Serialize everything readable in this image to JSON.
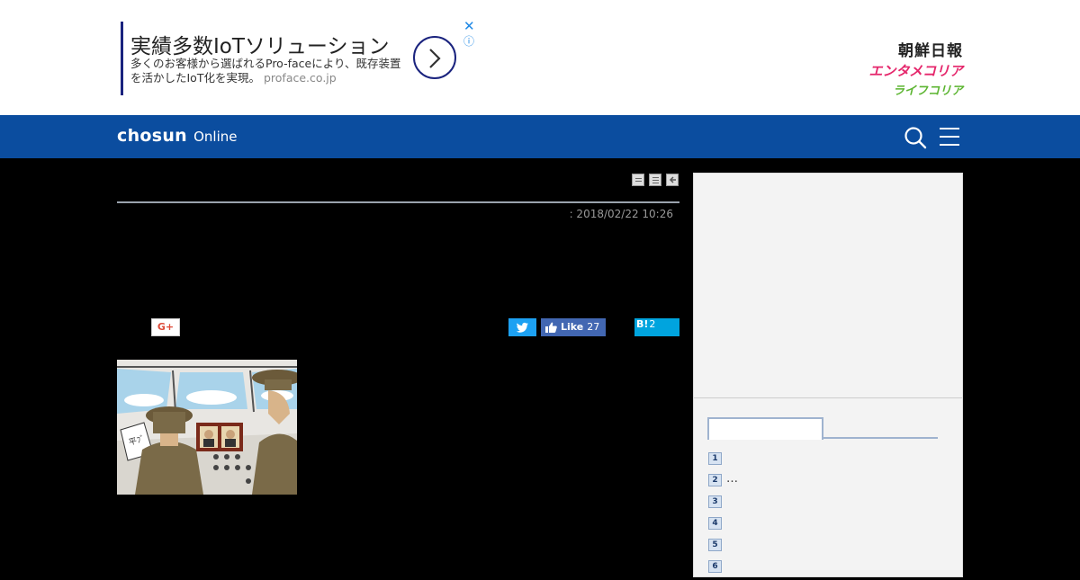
{
  "ad": {
    "title": "実績多数IoTソリューション",
    "description": "多くのお客様から選ばれるPro-faceにより、既存装置を活かしたIoT化を実現。",
    "domain": "proface.co.jp",
    "close_icon": "close-icon",
    "info_icon": "info-icon",
    "cta_icon": "chevron-right-icon"
  },
  "brands": {
    "chosun": "朝鮮日報",
    "entame": "エンタメコリア",
    "life": "ライフコリア",
    "entame_color": "#e5266b",
    "life_color": "#5cb531"
  },
  "nav": {
    "logo_main": "chosun",
    "logo_sub": "Online",
    "background": "#0b4d9f",
    "search_icon": "search-icon",
    "menu_icon": "hamburger-menu-icon"
  },
  "article": {
    "tool_icons": [
      "print-icon",
      "enlarge-text-icon",
      "back-icon"
    ],
    "date": ": 2018/02/22 10:26",
    "share": {
      "gplus_label": "G+",
      "facebook_label": "Like",
      "facebook_count": "27",
      "hatena_label": "B!",
      "hatena_count": "2"
    },
    "photo_icon": "cartoon-illustration"
  },
  "sidebar": {
    "ranking": [
      {
        "rank": "1",
        "text": ""
      },
      {
        "rank": "2",
        "text": "…"
      },
      {
        "rank": "3",
        "text": ""
      },
      {
        "rank": "4",
        "text": ""
      },
      {
        "rank": "5",
        "text": ""
      },
      {
        "rank": "6",
        "text": ""
      }
    ]
  }
}
